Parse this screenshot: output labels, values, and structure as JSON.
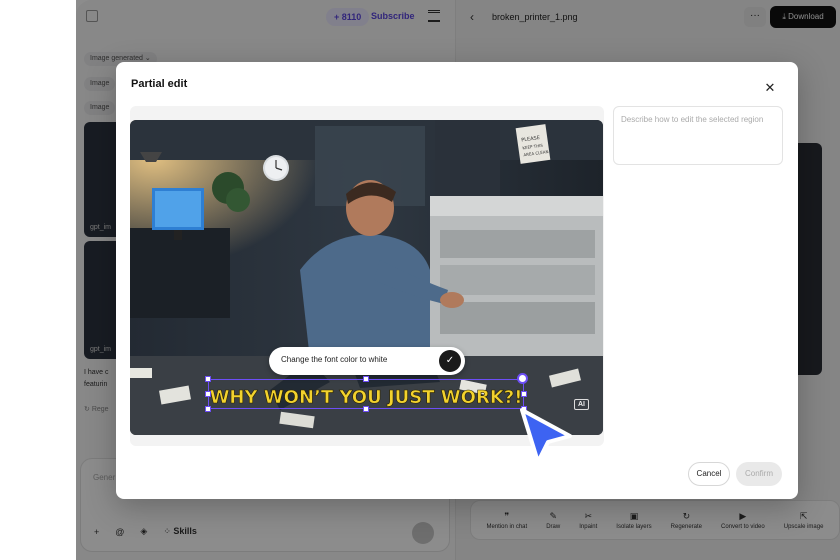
{
  "header": {
    "credits": "+ 8110",
    "subscribe_label": "Subscribe"
  },
  "left_panel": {
    "chips": [
      "Image generated",
      "Image",
      "Image"
    ],
    "thumbs": [
      "gpt_im",
      "gpt_im"
    ],
    "message_lines": [
      "I have c",
      "featurin"
    ],
    "regen_label": "Rege",
    "chat_placeholder": "Gener",
    "skills_label": "Skills"
  },
  "right_panel": {
    "file_title": "broken_printer_1.png",
    "more_label": "···",
    "download_label": "Download",
    "tools": [
      {
        "icon": "quote-icon",
        "glyph": "❞",
        "label": "Mention in chat"
      },
      {
        "icon": "draw-icon",
        "glyph": "✎",
        "label": "Draw"
      },
      {
        "icon": "scissors-icon",
        "glyph": "✂",
        "label": "Inpaint"
      },
      {
        "icon": "layers-icon",
        "glyph": "▣",
        "label": "Isolate layers"
      },
      {
        "icon": "refresh-icon",
        "glyph": "↻",
        "label": "Regenerate"
      },
      {
        "icon": "video-icon",
        "glyph": "▶",
        "label": "Convert to video"
      },
      {
        "icon": "upscale-icon",
        "glyph": "⇱",
        "label": "Upscale image"
      }
    ]
  },
  "modal": {
    "title": "Partial edit",
    "close_glyph": "✕",
    "prompt_text": "Change the font color to white",
    "check_glyph": "✓",
    "image_caption": "WHY WON’T YOU JUST WORK?!",
    "ai_badge": "AI",
    "description_placeholder": "Describe how to edit the selected region",
    "cancel_label": "Cancel",
    "confirm_label": "Confirm"
  },
  "colors": {
    "accent": "#6d4ef6",
    "caption_yellow": "#f2d22e",
    "cursor_blue": "#3d63f2"
  }
}
